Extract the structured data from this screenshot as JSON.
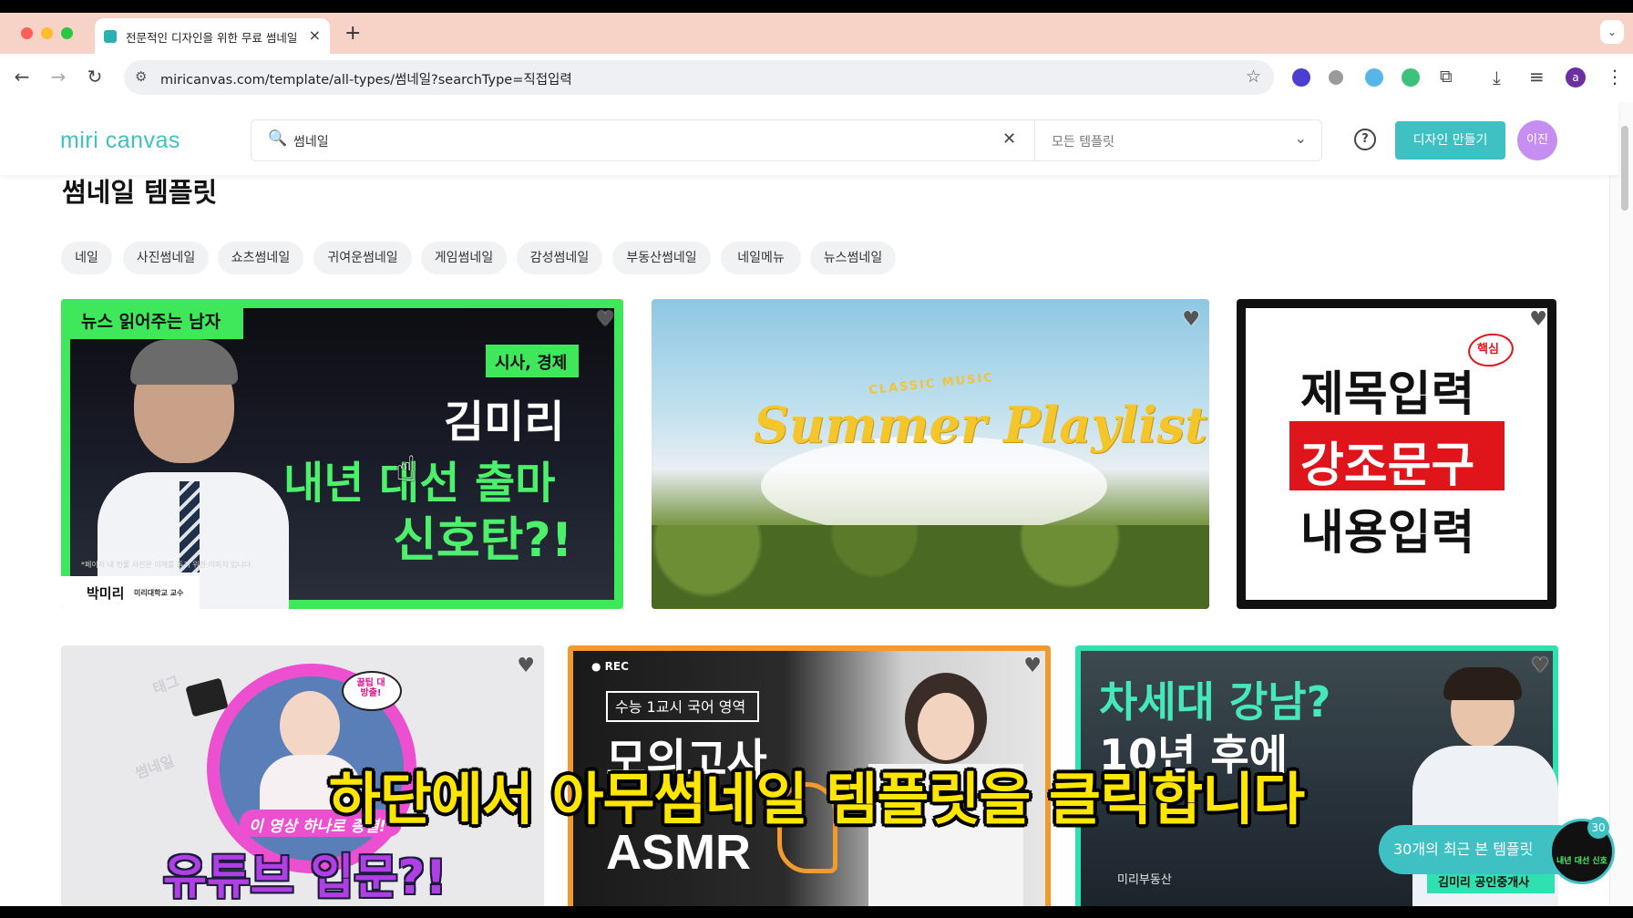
{
  "browser": {
    "tab_title": "전문적인 디자인을 위한 무료 썸네일",
    "tab_close": "×",
    "new_tab": "+",
    "tab_menu": "⌄",
    "url": "miricanvas.com/template/all-types/썸네일?searchType=직접입력",
    "back": "←",
    "forward": "→",
    "reload": "↻",
    "star": "☆",
    "tune": "⚙",
    "download": "⤓",
    "menu": "⋮",
    "profile": "a",
    "ext_puzzle": "⧉",
    "ext_list": "≡"
  },
  "header": {
    "logo": "miri canvas",
    "search_icon": "🔍",
    "search_value": "썸네일",
    "search_clear": "✕",
    "template_filter": "모든 템플릿",
    "chevron": "⌄",
    "help": "?",
    "create_button": "디자인 만들기",
    "avatar": "이진"
  },
  "page_title": "썸네일 템플릿",
  "chips": [
    "네일",
    "사진썸네일",
    "쇼츠썸네일",
    "귀여운썸네일",
    "게임썸네일",
    "감성썸네일",
    "부동산썸네일",
    "네일메뉴",
    "뉴스썸네일"
  ],
  "heart": "♥",
  "cards": {
    "news": {
      "tag": "뉴스 읽어주는 남자",
      "category": "시사, 경제",
      "name": "김미리",
      "line1": "내년 대선 출마",
      "line2": "신호탄?!",
      "disclaimer": "*페이지 내 인물 사진은 이해를 돕기 위한 이미지 입니다.",
      "caption_name": "박미리",
      "caption_role": "미리대학교 교수"
    },
    "summer": {
      "kicker": "CLASSIC MUSIC",
      "title": "Summer Playlist"
    },
    "title_card": {
      "line1": "제목입력",
      "line2": "강조문구",
      "line3": "내용입력",
      "badge": "핵심"
    },
    "youtube": {
      "bubble": "꿀팁 대방출!",
      "sub": "이 영상 하나로 종결!",
      "title": "유튜브 입문?!",
      "bg_word1": "태그",
      "bg_word2": "썸네일"
    },
    "asmr": {
      "rec": "● REC",
      "label": "수능 1교시 국어 영역",
      "title1": "모의고사",
      "title2": "ASMR"
    },
    "realestate": {
      "title1": "차세대 강남?",
      "title2": "10년 후에",
      "brand": "미리부동산",
      "agent": "김미리 공인중개사"
    }
  },
  "caption": "하단에서 아무썸네일 템플릿을 클릭합니다",
  "recent": {
    "label": "30개의 최근 본 템플릿",
    "count": "30",
    "thumb_text": "내년 대선 신호"
  }
}
